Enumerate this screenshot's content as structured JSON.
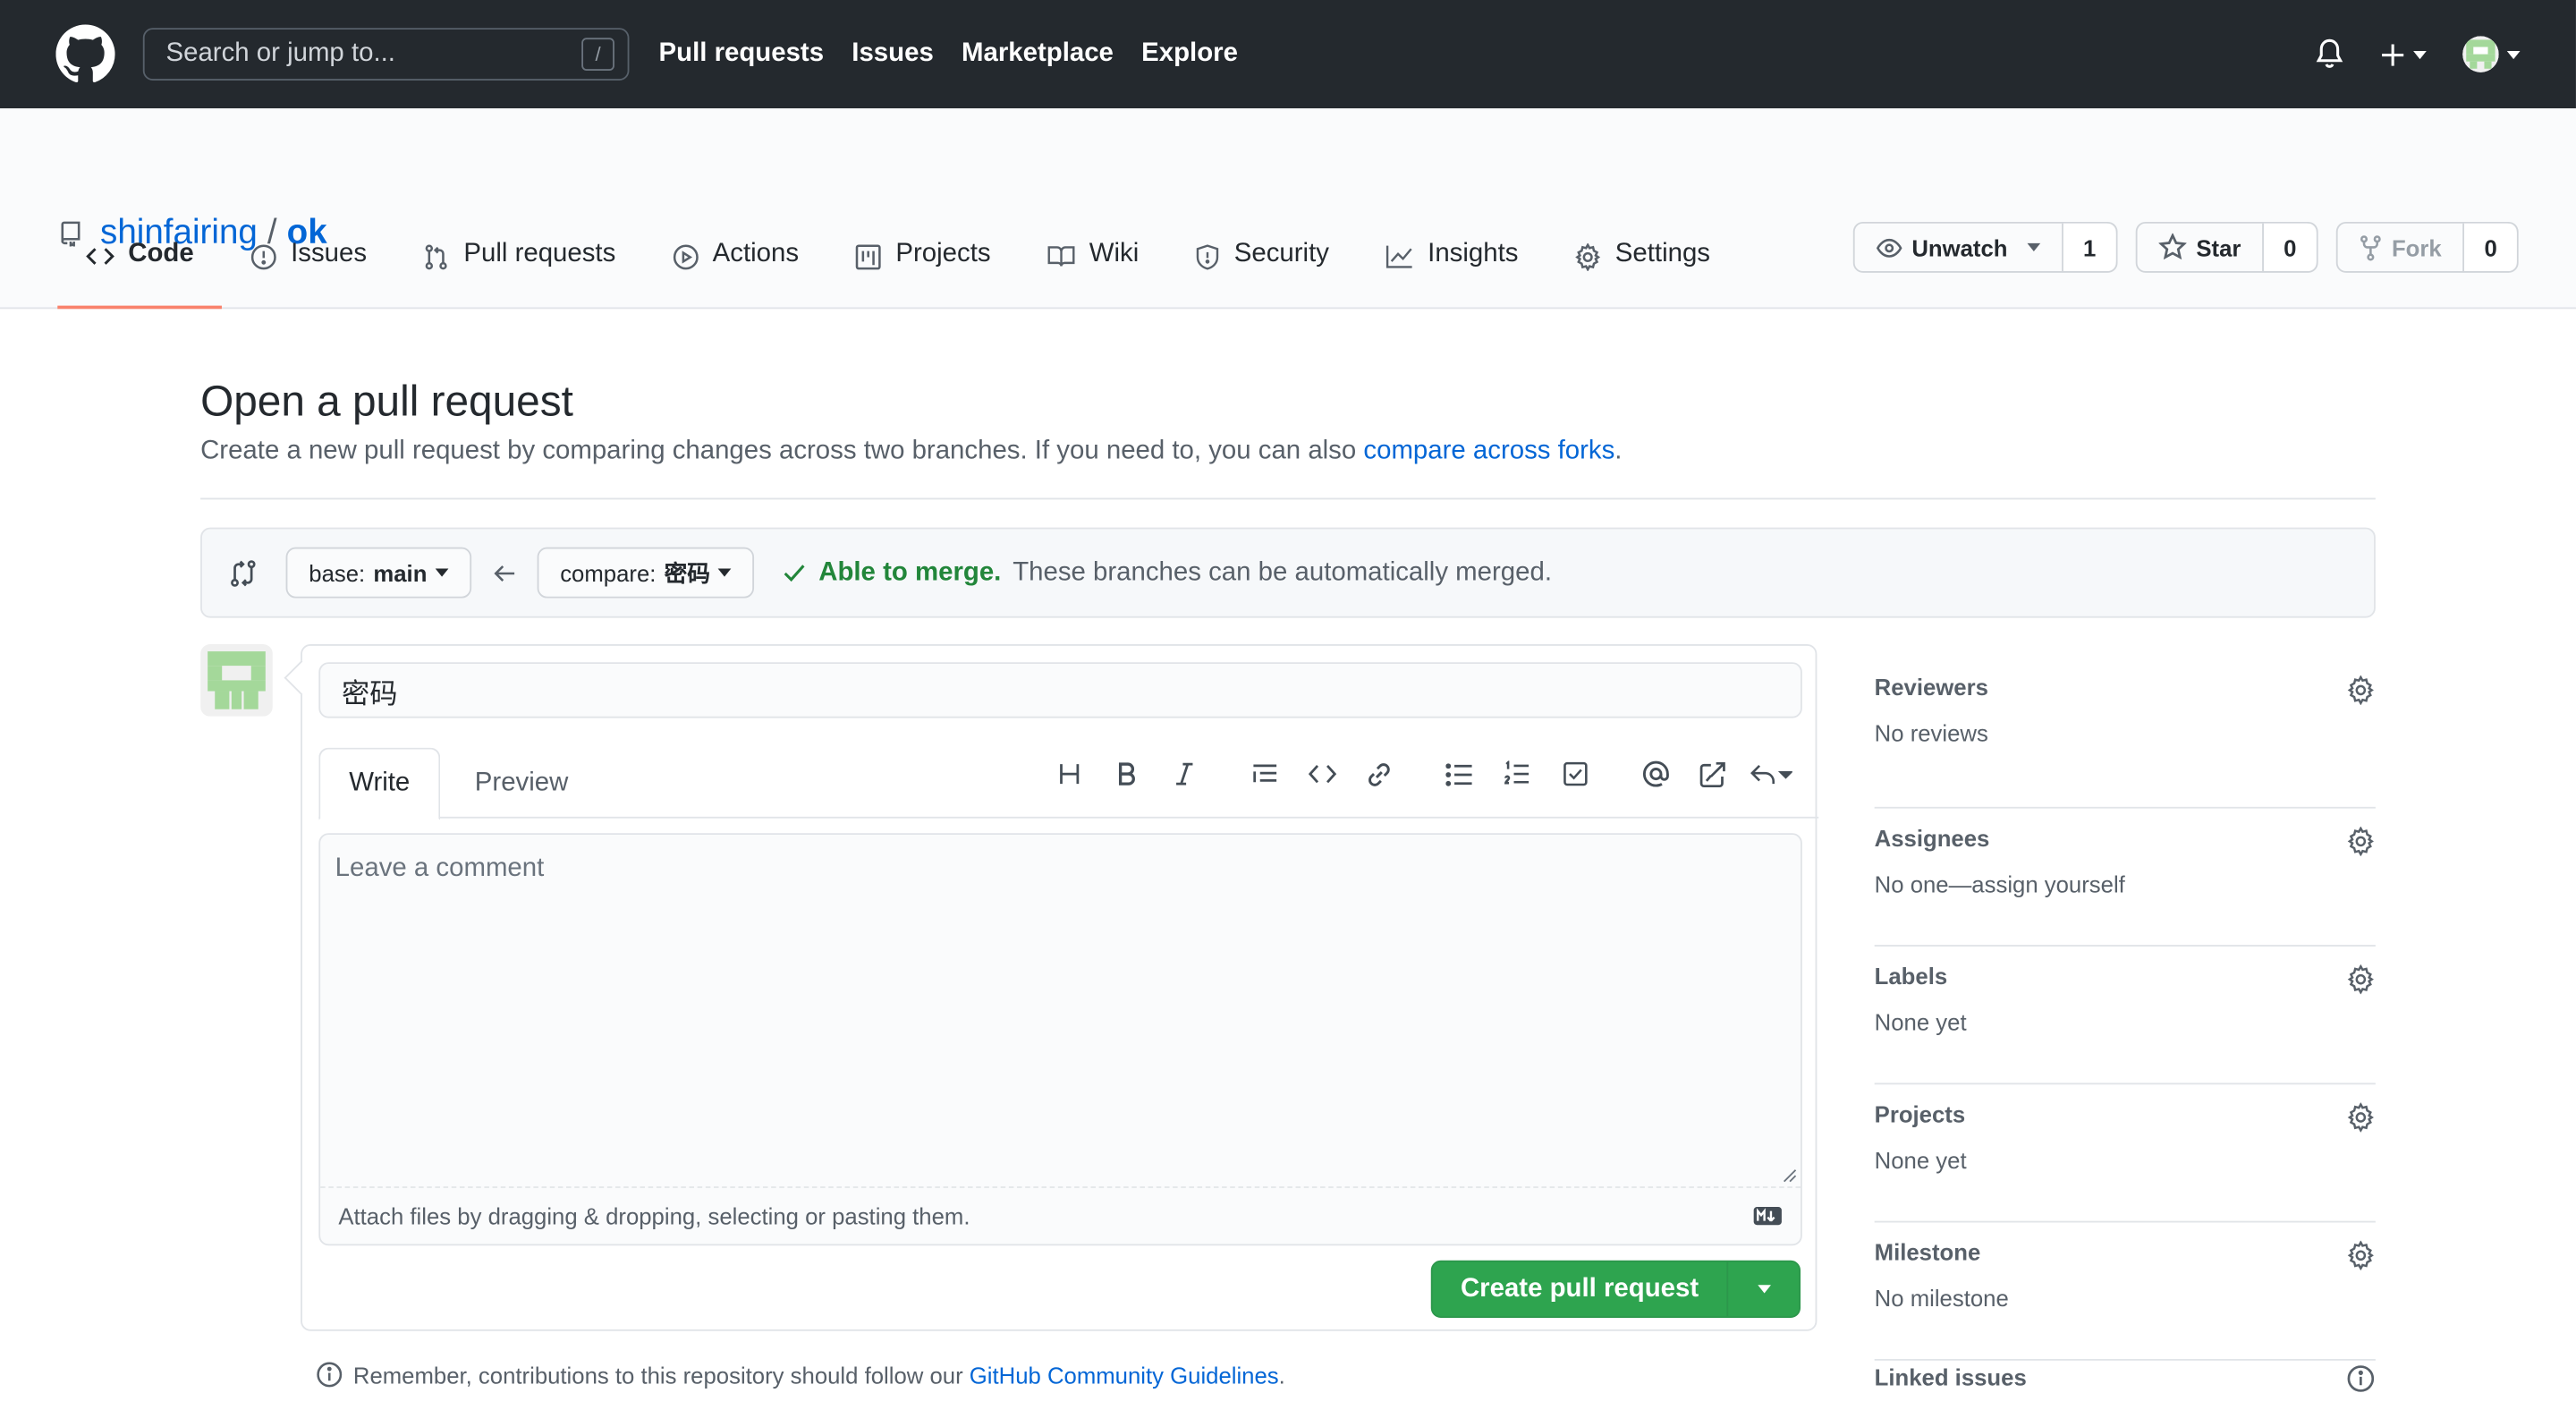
{
  "header": {
    "search_placeholder": "Search or jump to...",
    "search_shortcut": "/",
    "nav": [
      "Pull requests",
      "Issues",
      "Marketplace",
      "Explore"
    ]
  },
  "repo": {
    "owner": "shinfairing",
    "separator": "/",
    "name": "ok",
    "watch_label": "Unwatch",
    "watch_count": "1",
    "star_label": "Star",
    "star_count": "0",
    "fork_label": "Fork",
    "fork_count": "0"
  },
  "tabs": [
    "Code",
    "Issues",
    "Pull requests",
    "Actions",
    "Projects",
    "Wiki",
    "Security",
    "Insights",
    "Settings"
  ],
  "page": {
    "title": "Open a pull request",
    "subtitle_prefix": "Create a new pull request by comparing changes across two branches. If you need to, you can also ",
    "subtitle_link": "compare across forks",
    "subtitle_suffix": "."
  },
  "range": {
    "base_label": "base:",
    "base_value": "main",
    "compare_label": "compare:",
    "compare_value": "密码",
    "merge_title": "Able to merge.",
    "merge_text": "These branches can be automatically merged."
  },
  "composer": {
    "title_value": "密码",
    "tab_write": "Write",
    "tab_preview": "Preview",
    "comment_placeholder": "Leave a comment",
    "attach_text": "Attach files by dragging & dropping, selecting or pasting them.",
    "create_label": "Create pull request"
  },
  "guideline": {
    "prefix": "Remember, contributions to this repository should follow our ",
    "link": "GitHub Community Guidelines",
    "suffix": "."
  },
  "sidebar": [
    {
      "heading": "Reviewers",
      "value": "No reviews"
    },
    {
      "heading": "Assignees",
      "value": "No one—assign yourself"
    },
    {
      "heading": "Labels",
      "value": "None yet"
    },
    {
      "heading": "Projects",
      "value": "None yet"
    },
    {
      "heading": "Milestone",
      "value": "No milestone"
    }
  ],
  "sidebar_last": "Linked issues",
  "colors": {
    "header_bg": "#24292e",
    "link": "#0366d6",
    "success": "#2ea44f",
    "merge_green": "#22863a",
    "tab_underline": "#f9826c"
  }
}
